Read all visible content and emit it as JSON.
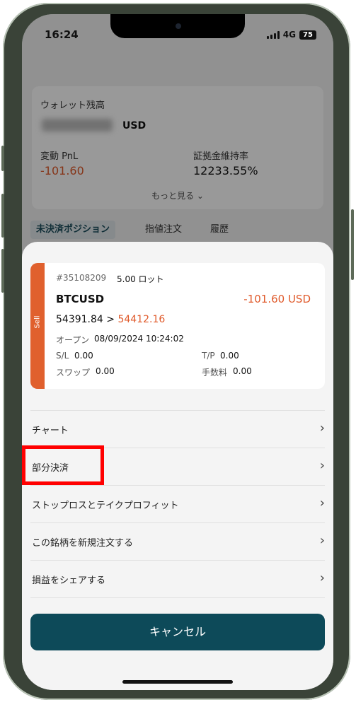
{
  "status_bar": {
    "time": "16:24",
    "network": "4G",
    "battery": "75"
  },
  "header": {
    "account_chevron": "⌄"
  },
  "wallet": {
    "title": "ウォレット残高",
    "currency": "USD",
    "pnl_label": "変動 PnL",
    "pnl_value": "-101.60",
    "margin_label": "証拠金維持率",
    "margin_value": "12233.55%",
    "more": "もっと見る ⌄"
  },
  "tabs": [
    {
      "label": "未決済ポジション",
      "active": true
    },
    {
      "label": "指値注文",
      "active": false
    },
    {
      "label": "履歴",
      "active": false
    }
  ],
  "position": {
    "side": "Sell",
    "ticket": "#35108209",
    "lots": "5.00 ロット",
    "symbol": "BTCUSD",
    "pnl": "-101.60 USD",
    "open_price": "54391.84",
    "arrow": ">",
    "current_price": "54412.16",
    "open_label": "オープン",
    "open_time": "08/09/2024 10:24:02",
    "sl_label": "S/L",
    "sl_value": "0.00",
    "tp_label": "T/P",
    "tp_value": "0.00",
    "swap_label": "スワップ",
    "swap_value": "0.00",
    "fee_label": "手数料",
    "fee_value": "0.00"
  },
  "menu": [
    {
      "label": "チャート"
    },
    {
      "label": "部分決済"
    },
    {
      "label": "ストップロスとテイクプロフィット"
    },
    {
      "label": "この銘柄を新規注文する"
    },
    {
      "label": "損益をシェアする"
    }
  ],
  "cancel_label": "キャンセル",
  "colors": {
    "accent": "#0d4a59",
    "loss": "#e05a2b",
    "sell_tag": "#e0602d",
    "highlight": "#ff0000"
  },
  "icons": [
    "signal-icon",
    "battery-icon",
    "logo-icon",
    "chevron-down-icon",
    "chevron-right-icon"
  ]
}
